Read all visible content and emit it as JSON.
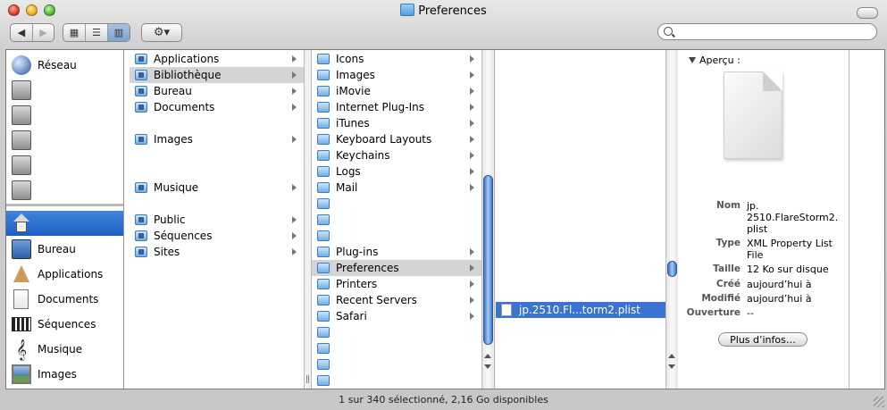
{
  "window": {
    "title": "Preferences"
  },
  "toolbar": {
    "back_label": "◀",
    "forward_label": "▶",
    "view_icons": "▦",
    "view_list": "☰",
    "view_columns": "▥",
    "action_label": "⚙▾",
    "search_value": ""
  },
  "sidebar": {
    "items": [
      {
        "label": "Réseau",
        "icon": "network-globe-icon"
      },
      {
        "label": "",
        "icon": "hard-disk-icon"
      },
      {
        "label": "",
        "icon": "hard-disk-icon"
      },
      {
        "label": "",
        "icon": "hard-disk-icon"
      },
      {
        "label": "",
        "icon": "hard-disk-icon"
      },
      {
        "label": "",
        "icon": "hard-disk-icon"
      },
      {
        "label": "",
        "icon": "home-icon"
      },
      {
        "label": "Bureau",
        "icon": "desktop-icon"
      },
      {
        "label": "Applications",
        "icon": "applications-icon"
      },
      {
        "label": "Documents",
        "icon": "documents-icon"
      },
      {
        "label": "Séquences",
        "icon": "movies-icon"
      },
      {
        "label": "Musique",
        "icon": "music-icon"
      },
      {
        "label": "Images",
        "icon": "pictures-icon"
      }
    ]
  },
  "column1": {
    "items": [
      "Applications",
      "Bibliothèque",
      "Bureau",
      "Documents",
      "",
      "Images",
      "",
      "",
      "Musique",
      "",
      "Public",
      "Séquences",
      "Sites"
    ]
  },
  "column2": {
    "items": [
      "Icons",
      "Images",
      "iMovie",
      "Internet Plug-Ins",
      "iTunes",
      "Keyboard Layouts",
      "Keychains",
      "Logs",
      "Mail",
      "",
      "",
      "",
      "Plug-ins",
      "Preferences",
      "Printers",
      "Recent Servers",
      "Safari",
      "",
      "",
      "",
      ""
    ]
  },
  "column3": {
    "items": [
      "jp.2510.Fl...torm2.plist"
    ]
  },
  "preview": {
    "header": "Aperçu :",
    "name_key": "Nom",
    "name_value": "jp. 2510.FlareStorm2. plist",
    "type_key": "Type",
    "type_value": "XML Property List File",
    "size_key": "Taille",
    "size_value": "12 Ko sur disque",
    "created_key": "Créé",
    "created_value": "aujourd’hui à",
    "modified_key": "Modifié",
    "modified_value": "aujourd’hui à",
    "opened_key": "Ouverture",
    "opened_value": "--",
    "more_info_label": "Plus d’infos…"
  },
  "status": {
    "text": "1 sur 340 sélectionné, 2,16 Go disponibles"
  },
  "colors": {
    "selection_blue": "#3a74d0",
    "sidebar_selection": "#1d5fc5"
  }
}
